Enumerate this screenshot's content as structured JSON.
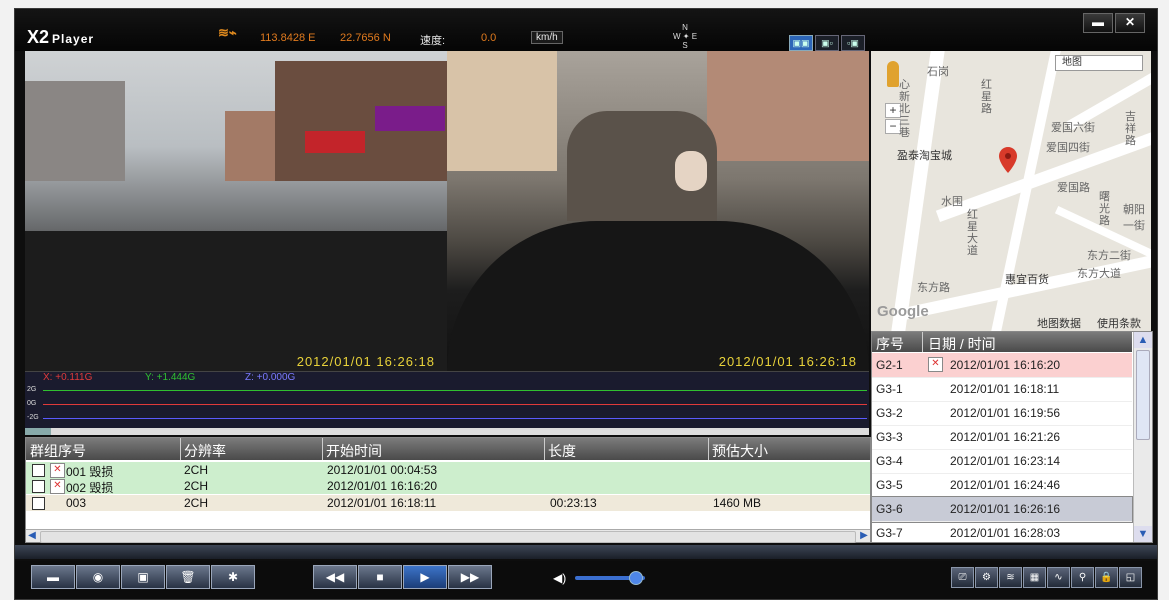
{
  "app": {
    "logo": "X2",
    "logo_sub": "Player"
  },
  "header": {
    "longitude": "113.8428 E",
    "latitude": "22.7656 N",
    "speed_label": "速度:",
    "speed_value": "0.0",
    "speed_unit": "km/h",
    "compass": {
      "n": "N",
      "w": "W",
      "e": "E",
      "s": "S"
    }
  },
  "window": {
    "minimize": "▬",
    "close": "✕"
  },
  "video": {
    "cam1_timestamp": "2012/01/01   16:26:18",
    "cam2_timestamp": "2012/01/01   16:26:18"
  },
  "gsensor": {
    "x_label": "X: +0.111G",
    "y_label": "Y: +1.444G",
    "z_label": "Z: +0.000G",
    "ticks": [
      "2G",
      "0G",
      "-2G"
    ],
    "colors": {
      "x": "#e03a3a",
      "y": "#30c030",
      "z": "#5a5aff"
    }
  },
  "file_table": {
    "headers": [
      "群组序号",
      "分辨率",
      "开始时间",
      "长度",
      "预估大小"
    ],
    "rows": [
      {
        "group": "001 毁损",
        "res": "2CH",
        "start": "2012/01/01 00:04:53",
        "length": "",
        "size": ""
      },
      {
        "group": "002 毁损",
        "res": "2CH",
        "start": "2012/01/01 16:16:20",
        "length": "",
        "size": ""
      },
      {
        "group": "003",
        "res": "2CH",
        "start": "2012/01/01 16:18:11",
        "length": "00:23:13",
        "size": "1460 MB"
      }
    ]
  },
  "map": {
    "type_select": "地图",
    "labels": {
      "shigang": "石岗",
      "hongxing": "红星路",
      "xinbei": "心新北三巷",
      "aiguoliu": "爱国六街",
      "aiguosi": "爱国四街",
      "jixiang": "吉祥路",
      "taobao": "盈泰淘宝城",
      "aiguo": "爱国路",
      "shuguang": "曙光路",
      "chaoyang": "朝阳一街",
      "shuiwei": "水围",
      "hongxingdadao": "红星大道",
      "dongfang2": "东方二街",
      "dongfangdadao": "东方大道",
      "dongfanglu": "东方路",
      "huiyi": "惠宜百货",
      "attribution": "地图数据",
      "terms": "使用条款",
      "google": "Google"
    },
    "zoom_in": "+",
    "zoom_out": "−"
  },
  "event_list": {
    "headers": [
      "序号",
      "日期 / 时间"
    ],
    "rows": [
      {
        "id": "G2-1",
        "dt": "2012/01/01  16:16:20"
      },
      {
        "id": "G3-1",
        "dt": "2012/01/01  16:18:11"
      },
      {
        "id": "G3-2",
        "dt": "2012/01/01  16:19:56"
      },
      {
        "id": "G3-3",
        "dt": "2012/01/01  16:21:26"
      },
      {
        "id": "G3-4",
        "dt": "2012/01/01  16:23:14"
      },
      {
        "id": "G3-5",
        "dt": "2012/01/01  16:24:46"
      },
      {
        "id": "G3-6",
        "dt": "2012/01/01  16:26:16"
      },
      {
        "id": "G3-7",
        "dt": "2012/01/01  16:28:03"
      }
    ]
  },
  "controls": {
    "open": "▬",
    "snapshot": "◉",
    "save": "▣",
    "delete": "🗑",
    "settings": "✱",
    "rewind": "◀◀",
    "stop": "■",
    "play": "▶",
    "forward": "▶▶",
    "volume_icon": "◀)",
    "volume_level": 0.85
  }
}
